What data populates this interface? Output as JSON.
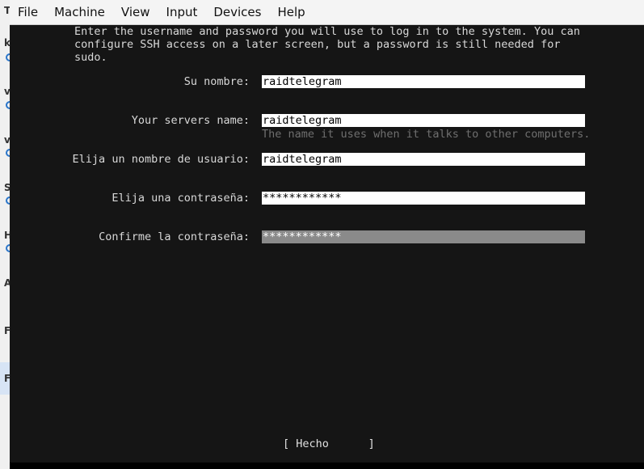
{
  "menubar": {
    "items": [
      "File",
      "Machine",
      "View",
      "Input",
      "Devices",
      "Help"
    ]
  },
  "host_sidebar": {
    "letters": [
      "T",
      "k",
      "v",
      "v",
      "S",
      "H",
      "A",
      "F",
      "F"
    ]
  },
  "installer": {
    "intro_lines": [
      "Enter the username and password you will use to log in to the system. You can",
      "configure SSH access on a later screen, but a password is still needed for",
      "sudo."
    ],
    "fields": [
      {
        "label": "Su nombre:",
        "value": "raidtelegram",
        "hint": ""
      },
      {
        "label": "Your servers name:",
        "value": "raidtelegram",
        "hint": "The name it uses when it talks to other computers."
      },
      {
        "label": "Elija un nombre de usuario:",
        "value": "raidtelegram",
        "hint": ""
      },
      {
        "label": "Elija una contraseña:",
        "value": "************",
        "hint": ""
      },
      {
        "label": "Confirme la contraseña:",
        "value": "************",
        "hint": "",
        "focused": true
      }
    ],
    "done_button": "[ Hecho      ]"
  }
}
